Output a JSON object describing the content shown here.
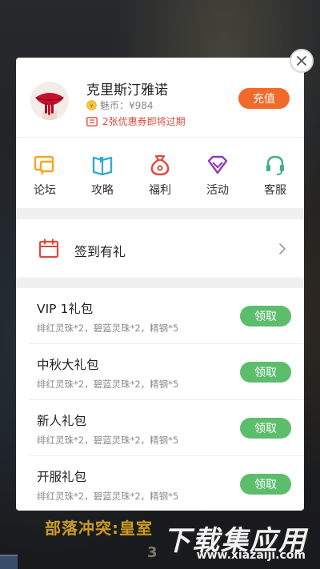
{
  "profile": {
    "username": "克里斯汀雅诺",
    "coins": "魅币：¥984",
    "coupon_notice": "2张优惠券即将过期",
    "recharge_label": "充值"
  },
  "nav": [
    {
      "label": "论坛",
      "icon": "forum-icon",
      "color": "#f5a623"
    },
    {
      "label": "攻略",
      "icon": "guide-icon",
      "color": "#33aacc"
    },
    {
      "label": "福利",
      "icon": "gift-bag-icon",
      "color": "#e24a3b"
    },
    {
      "label": "活动",
      "icon": "diamond-icon",
      "color": "#8e3fb5"
    },
    {
      "label": "客服",
      "icon": "headset-icon",
      "color": "#3fb08a"
    }
  ],
  "checkin": {
    "label": "签到有礼"
  },
  "gifts": [
    {
      "title": "VIP 1礼包",
      "desc": "绯红灵珠*2，碧蓝灵珠*2，精钢*5",
      "button": "领取"
    },
    {
      "title": "中秋大礼包",
      "desc": "绯红灵珠*2，碧蓝灵珠*2，精钢*5",
      "button": "领取"
    },
    {
      "title": "新人礼包",
      "desc": "绯红灵珠*2，碧蓝灵珠*2，精钢*5",
      "button": "领取"
    },
    {
      "title": "开服礼包",
      "desc": "绯红灵珠*2，碧蓝灵珠*2，精钢*5",
      "button": "领取"
    }
  ],
  "background": {
    "game_title": "部落冲突:皇室",
    "game_sub": "3",
    "watermark_main": "下载集应用",
    "watermark_url": "www.xiazaiji.com"
  },
  "colors": {
    "accent_orange": "#f26a2b",
    "claim_green": "#5cbd6c",
    "coupon_red": "#e0493c"
  }
}
